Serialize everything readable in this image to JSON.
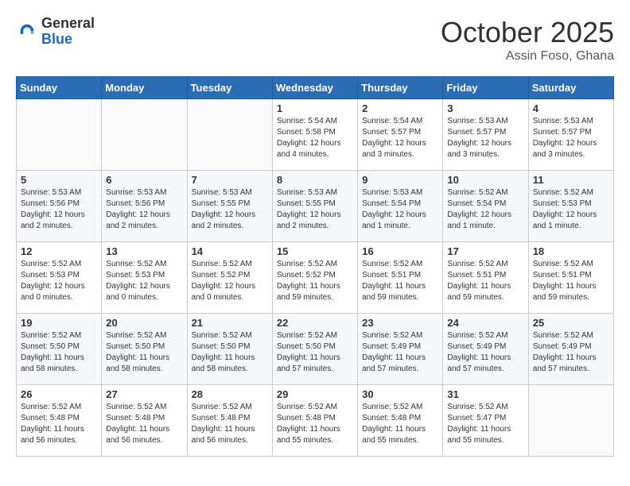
{
  "header": {
    "logo_general": "General",
    "logo_blue": "Blue",
    "month": "October 2025",
    "location": "Assin Foso, Ghana"
  },
  "weekdays": [
    "Sunday",
    "Monday",
    "Tuesday",
    "Wednesday",
    "Thursday",
    "Friday",
    "Saturday"
  ],
  "weeks": [
    [
      {
        "day": "",
        "content": ""
      },
      {
        "day": "",
        "content": ""
      },
      {
        "day": "",
        "content": ""
      },
      {
        "day": "1",
        "content": "Sunrise: 5:54 AM\nSunset: 5:58 PM\nDaylight: 12 hours\nand 4 minutes."
      },
      {
        "day": "2",
        "content": "Sunrise: 5:54 AM\nSunset: 5:57 PM\nDaylight: 12 hours\nand 3 minutes."
      },
      {
        "day": "3",
        "content": "Sunrise: 5:53 AM\nSunset: 5:57 PM\nDaylight: 12 hours\nand 3 minutes."
      },
      {
        "day": "4",
        "content": "Sunrise: 5:53 AM\nSunset: 5:57 PM\nDaylight: 12 hours\nand 3 minutes."
      }
    ],
    [
      {
        "day": "5",
        "content": "Sunrise: 5:53 AM\nSunset: 5:56 PM\nDaylight: 12 hours\nand 2 minutes."
      },
      {
        "day": "6",
        "content": "Sunrise: 5:53 AM\nSunset: 5:56 PM\nDaylight: 12 hours\nand 2 minutes."
      },
      {
        "day": "7",
        "content": "Sunrise: 5:53 AM\nSunset: 5:55 PM\nDaylight: 12 hours\nand 2 minutes."
      },
      {
        "day": "8",
        "content": "Sunrise: 5:53 AM\nSunset: 5:55 PM\nDaylight: 12 hours\nand 2 minutes."
      },
      {
        "day": "9",
        "content": "Sunrise: 5:53 AM\nSunset: 5:54 PM\nDaylight: 12 hours\nand 1 minute."
      },
      {
        "day": "10",
        "content": "Sunrise: 5:52 AM\nSunset: 5:54 PM\nDaylight: 12 hours\nand 1 minute."
      },
      {
        "day": "11",
        "content": "Sunrise: 5:52 AM\nSunset: 5:53 PM\nDaylight: 12 hours\nand 1 minute."
      }
    ],
    [
      {
        "day": "12",
        "content": "Sunrise: 5:52 AM\nSunset: 5:53 PM\nDaylight: 12 hours\nand 0 minutes."
      },
      {
        "day": "13",
        "content": "Sunrise: 5:52 AM\nSunset: 5:53 PM\nDaylight: 12 hours\nand 0 minutes."
      },
      {
        "day": "14",
        "content": "Sunrise: 5:52 AM\nSunset: 5:52 PM\nDaylight: 12 hours\nand 0 minutes."
      },
      {
        "day": "15",
        "content": "Sunrise: 5:52 AM\nSunset: 5:52 PM\nDaylight: 11 hours\nand 59 minutes."
      },
      {
        "day": "16",
        "content": "Sunrise: 5:52 AM\nSunset: 5:51 PM\nDaylight: 11 hours\nand 59 minutes."
      },
      {
        "day": "17",
        "content": "Sunrise: 5:52 AM\nSunset: 5:51 PM\nDaylight: 11 hours\nand 59 minutes."
      },
      {
        "day": "18",
        "content": "Sunrise: 5:52 AM\nSunset: 5:51 PM\nDaylight: 11 hours\nand 59 minutes."
      }
    ],
    [
      {
        "day": "19",
        "content": "Sunrise: 5:52 AM\nSunset: 5:50 PM\nDaylight: 11 hours\nand 58 minutes."
      },
      {
        "day": "20",
        "content": "Sunrise: 5:52 AM\nSunset: 5:50 PM\nDaylight: 11 hours\nand 58 minutes."
      },
      {
        "day": "21",
        "content": "Sunrise: 5:52 AM\nSunset: 5:50 PM\nDaylight: 11 hours\nand 58 minutes."
      },
      {
        "day": "22",
        "content": "Sunrise: 5:52 AM\nSunset: 5:50 PM\nDaylight: 11 hours\nand 57 minutes."
      },
      {
        "day": "23",
        "content": "Sunrise: 5:52 AM\nSunset: 5:49 PM\nDaylight: 11 hours\nand 57 minutes."
      },
      {
        "day": "24",
        "content": "Sunrise: 5:52 AM\nSunset: 5:49 PM\nDaylight: 11 hours\nand 57 minutes."
      },
      {
        "day": "25",
        "content": "Sunrise: 5:52 AM\nSunset: 5:49 PM\nDaylight: 11 hours\nand 57 minutes."
      }
    ],
    [
      {
        "day": "26",
        "content": "Sunrise: 5:52 AM\nSunset: 5:48 PM\nDaylight: 11 hours\nand 56 minutes."
      },
      {
        "day": "27",
        "content": "Sunrise: 5:52 AM\nSunset: 5:48 PM\nDaylight: 11 hours\nand 56 minutes."
      },
      {
        "day": "28",
        "content": "Sunrise: 5:52 AM\nSunset: 5:48 PM\nDaylight: 11 hours\nand 56 minutes."
      },
      {
        "day": "29",
        "content": "Sunrise: 5:52 AM\nSunset: 5:48 PM\nDaylight: 11 hours\nand 55 minutes."
      },
      {
        "day": "30",
        "content": "Sunrise: 5:52 AM\nSunset: 5:48 PM\nDaylight: 11 hours\nand 55 minutes."
      },
      {
        "day": "31",
        "content": "Sunrise: 5:52 AM\nSunset: 5:47 PM\nDaylight: 11 hours\nand 55 minutes."
      },
      {
        "day": "",
        "content": ""
      }
    ]
  ]
}
